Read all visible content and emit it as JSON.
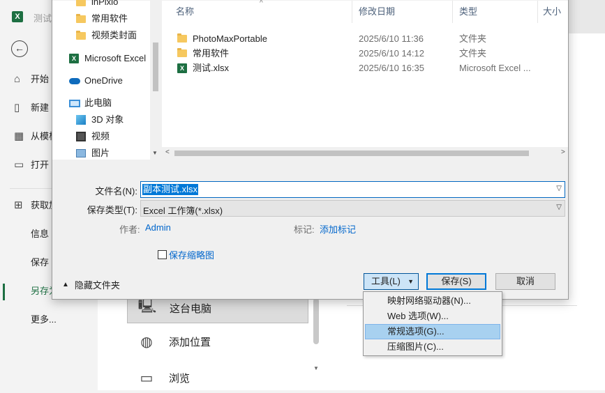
{
  "backstage": {
    "title": "测试",
    "items": [
      {
        "label": "开始",
        "icon": "home-icon"
      },
      {
        "label": "新建",
        "icon": "new-doc-icon"
      },
      {
        "label": "从模板",
        "icon": "template-icon"
      },
      {
        "label": "打开",
        "icon": "open-folder-icon"
      },
      {
        "label": "获取加",
        "icon": "addins-icon"
      },
      {
        "label": "信息"
      },
      {
        "label": "保存"
      },
      {
        "label": "另存为"
      },
      {
        "label": "更多..."
      }
    ],
    "locations": [
      {
        "label": "这台电脑",
        "icon": "this-pc-icon"
      },
      {
        "label": "添加位置",
        "icon": "globe-icon"
      },
      {
        "label": "浏览",
        "icon": "browse-folder-icon"
      }
    ]
  },
  "dialog": {
    "nav_items": [
      {
        "label": "inPixio",
        "icon": "folder-icon"
      },
      {
        "label": "常用软件",
        "icon": "folder-icon"
      },
      {
        "label": "视频类封面",
        "icon": "folder-icon"
      },
      {
        "label": "Microsoft Excel",
        "icon": "excel-icon"
      },
      {
        "label": "OneDrive",
        "icon": "onedrive-icon"
      },
      {
        "label": "此电脑",
        "icon": "this-pc-icon"
      },
      {
        "label": "3D 对象",
        "icon": "3d-objects-icon"
      },
      {
        "label": "视频",
        "icon": "video-icon"
      },
      {
        "label": "图片",
        "icon": "pictures-icon"
      }
    ],
    "columns": {
      "name": "名称",
      "modified": "修改日期",
      "type": "类型",
      "size": "大小"
    },
    "files": [
      {
        "name": "PhotoMaxPortable",
        "modified": "2025/6/10 11:36",
        "type": "文件夹",
        "icon": "folder-icon"
      },
      {
        "name": "常用软件",
        "modified": "2025/6/10 14:12",
        "type": "文件夹",
        "icon": "folder-icon"
      },
      {
        "name": "测试.xlsx",
        "modified": "2025/6/10 16:35",
        "type": "Microsoft Excel ...",
        "icon": "excel-file-icon"
      }
    ],
    "filename_label": "文件名(N):",
    "filename_value": "副本测试.xlsx",
    "filetype_label": "保存类型(T):",
    "filetype_value": "Excel 工作簿(*.xlsx)",
    "author_label": "作者:",
    "author_value": "Admin",
    "tags_label": "标记:",
    "tags_value": "添加标记",
    "thumbnail_label": "保存缩略图",
    "hide_folders_label": "隐藏文件夹",
    "tools_label": "工具(L)",
    "save_label": "保存(S)",
    "cancel_label": "取消"
  },
  "tools_menu": {
    "items": [
      {
        "label": "映射网络驱动器(N)..."
      },
      {
        "label": "Web 选项(W)..."
      },
      {
        "label": "常规选项(G)...",
        "highlighted": true
      },
      {
        "label": "压缩图片(C)..."
      }
    ]
  }
}
